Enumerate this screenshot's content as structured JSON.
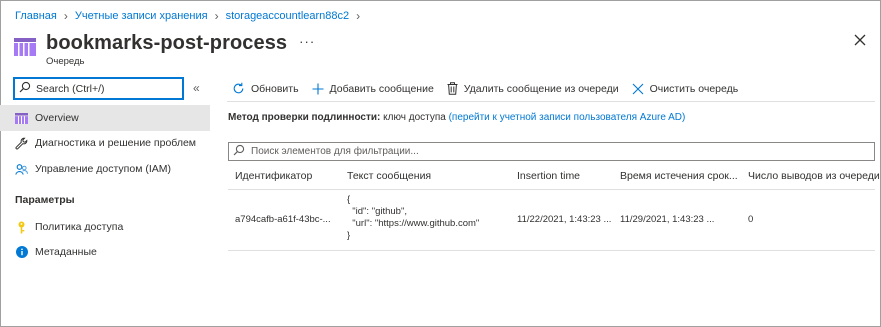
{
  "breadcrumb": {
    "items": [
      "Главная",
      "Учетные записи хранения",
      "storageaccountlearn88c2"
    ]
  },
  "header": {
    "title": "bookmarks-post-process",
    "subtitle": "Очередь",
    "more": "···"
  },
  "sidebar": {
    "search_placeholder": "Search (Ctrl+/)",
    "collapse": "«",
    "items": [
      {
        "label": "Overview",
        "icon": "queue-icon"
      },
      {
        "label": "Диагностика и решение проблем",
        "icon": "wrench-icon"
      },
      {
        "label": "Управление доступом (IAM)",
        "icon": "people-icon"
      }
    ],
    "section_title": "Параметры",
    "settings_items": [
      {
        "label": "Политика доступа",
        "icon": "key-icon"
      },
      {
        "label": "Метаданные",
        "icon": "info-icon"
      }
    ]
  },
  "toolbar": {
    "refresh": "Обновить",
    "add": "Добавить сообщение",
    "delete": "Удалить сообщение из очереди",
    "clear": "Очистить очередь"
  },
  "auth": {
    "label": "Метод проверки подлинности:",
    "value": "ключ доступа",
    "link": "(перейти к учетной записи пользователя Azure AD)"
  },
  "filter": {
    "placeholder": "Поиск элементов для фильтрации..."
  },
  "table": {
    "columns": [
      "Идентификатор",
      "Текст сообщения",
      "Insertion time",
      "Время истечения срок...",
      "Число выводов из очереди"
    ],
    "rows": [
      {
        "id": "a794cafb-a61f-43bc-...",
        "message": "{\n  \"id\": \"github\",\n  \"url\": \"https://www.github.com\"\n}",
        "insertion_time": "11/22/2021, 1:43:23 ...",
        "expiration_time": "11/29/2021, 1:43:23 ...",
        "dequeue_count": "0"
      }
    ]
  },
  "colors": {
    "accent": "#0078d4",
    "queue_icon": "#8661c5",
    "key_icon": "#f2c811"
  }
}
